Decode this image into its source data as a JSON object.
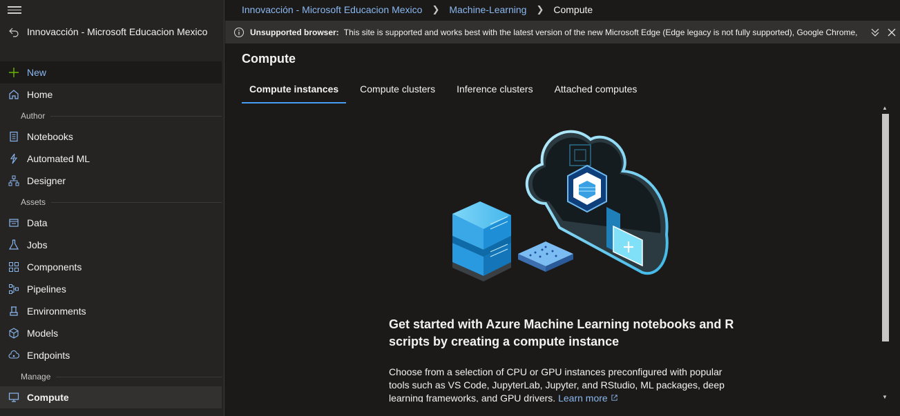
{
  "sidebar": {
    "workspace_name": "Innovacción - Microsoft Educacion Mexico",
    "new_label": "New",
    "home_label": "Home",
    "sections": {
      "author": "Author",
      "assets": "Assets",
      "manage": "Manage"
    },
    "author_items": [
      {
        "label": "Notebooks",
        "icon": "notebook-icon"
      },
      {
        "label": "Automated ML",
        "icon": "automated-ml-icon"
      },
      {
        "label": "Designer",
        "icon": "designer-icon"
      }
    ],
    "asset_items": [
      {
        "label": "Data",
        "icon": "data-icon"
      },
      {
        "label": "Jobs",
        "icon": "flask-icon"
      },
      {
        "label": "Components",
        "icon": "components-icon"
      },
      {
        "label": "Pipelines",
        "icon": "pipelines-icon"
      },
      {
        "label": "Environments",
        "icon": "environments-icon"
      },
      {
        "label": "Models",
        "icon": "cube-icon"
      },
      {
        "label": "Endpoints",
        "icon": "cloud-endpoint-icon"
      }
    ],
    "manage_items": [
      {
        "label": "Compute",
        "icon": "monitor-icon",
        "active": true
      }
    ]
  },
  "breadcrumb": {
    "items": [
      "Innovacción - Microsoft Educacion Mexico",
      "Machine-Learning",
      "Compute"
    ]
  },
  "warning": {
    "title": "Unsupported browser:",
    "message": "This site is supported and works best with the latest version of the new Microsoft Edge (Edge legacy is not fully supported), Google Chrome, ..."
  },
  "page": {
    "title": "Compute",
    "tabs": [
      {
        "label": "Compute instances",
        "active": true
      },
      {
        "label": "Compute clusters",
        "active": false
      },
      {
        "label": "Inference clusters",
        "active": false
      },
      {
        "label": "Attached computes",
        "active": false
      }
    ]
  },
  "empty_state": {
    "heading": "Get started with Azure Machine Learning notebooks and R scripts by creating a compute instance",
    "description": "Choose from a selection of CPU or GPU instances preconfigured with popular tools such as VS Code, JupyterLab, Jupyter, and RStudio, ML packages, deep learning frameworks, and GPU drivers.",
    "learn_more": "Learn more"
  },
  "colors": {
    "accent": "#479ef5",
    "link": "#8ab8f0",
    "new_plus": "#6bb700"
  }
}
